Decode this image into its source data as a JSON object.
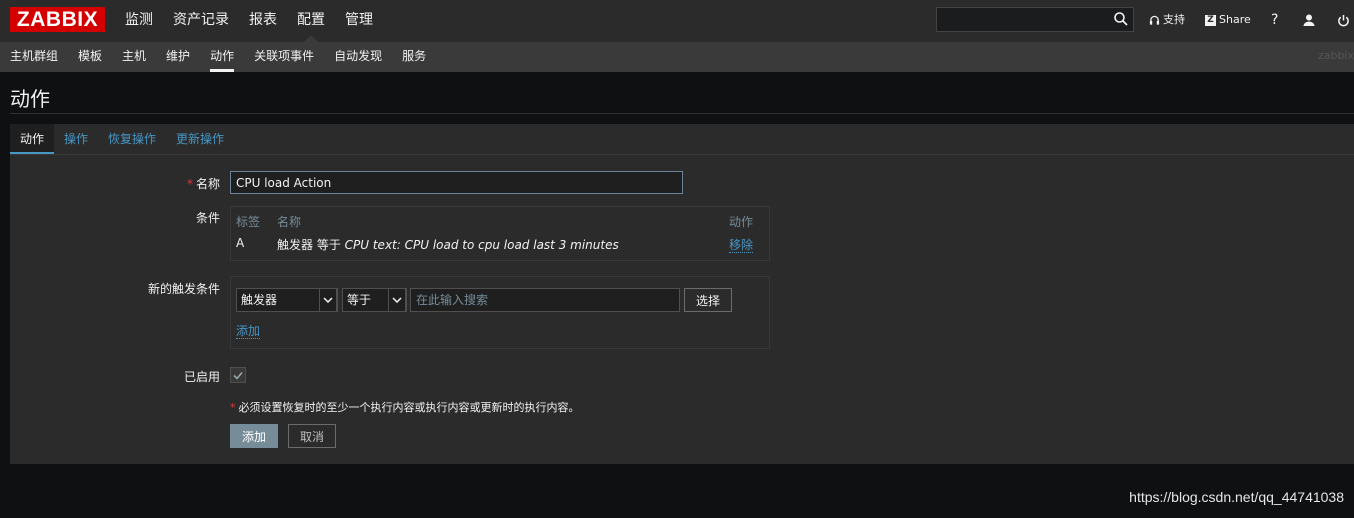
{
  "header": {
    "logo": "ZABBIX",
    "menu": [
      {
        "label": "监测"
      },
      {
        "label": "资产记录"
      },
      {
        "label": "报表"
      },
      {
        "label": "配置",
        "active": true
      },
      {
        "label": "管理"
      }
    ],
    "search_value": "",
    "support_label": "支持",
    "share_label": "Share",
    "help_label": "?"
  },
  "subnav": {
    "items": [
      {
        "label": "主机群组"
      },
      {
        "label": "模板"
      },
      {
        "label": "主机"
      },
      {
        "label": "维护"
      },
      {
        "label": "动作",
        "active": true
      },
      {
        "label": "关联项事件"
      },
      {
        "label": "自动发现"
      },
      {
        "label": "服务"
      }
    ],
    "server": "zabbix"
  },
  "page": {
    "title": "动作"
  },
  "tabs": [
    {
      "label": "动作",
      "active": true
    },
    {
      "label": "操作"
    },
    {
      "label": "恢复操作"
    },
    {
      "label": "更新操作"
    }
  ],
  "form": {
    "name_required": "*",
    "name_label": "名称",
    "name_value": "CPU load Action",
    "conditions_label": "条件",
    "conditions_table": {
      "headers": {
        "tag": "标签",
        "name": "名称",
        "action": "动作"
      },
      "rows": [
        {
          "tag": "A",
          "name_prefix": "触发器 等于 ",
          "name_value": "CPU text: CPU load to cpu load last 3 minutes",
          "action": "移除"
        }
      ]
    },
    "new_condition_label": "新的触发条件",
    "new_condition": {
      "type_selected": "触发器",
      "operator_selected": "等于",
      "search_placeholder": "在此输入搜索",
      "select_button": "选择",
      "add_link": "添加"
    },
    "enabled_label": "已启用",
    "enabled": true,
    "note_required": "*",
    "note": "必须设置恢复时的至少一个执行内容或执行内容或更新时的执行内容。",
    "add_button": "添加",
    "cancel_button": "取消"
  },
  "watermark": "https://blog.csdn.net/qq_44741038",
  "colors": {
    "brand": "#d40000",
    "link": "#4796c4",
    "background": "#0e1012",
    "panel": "#2b2b2b"
  }
}
